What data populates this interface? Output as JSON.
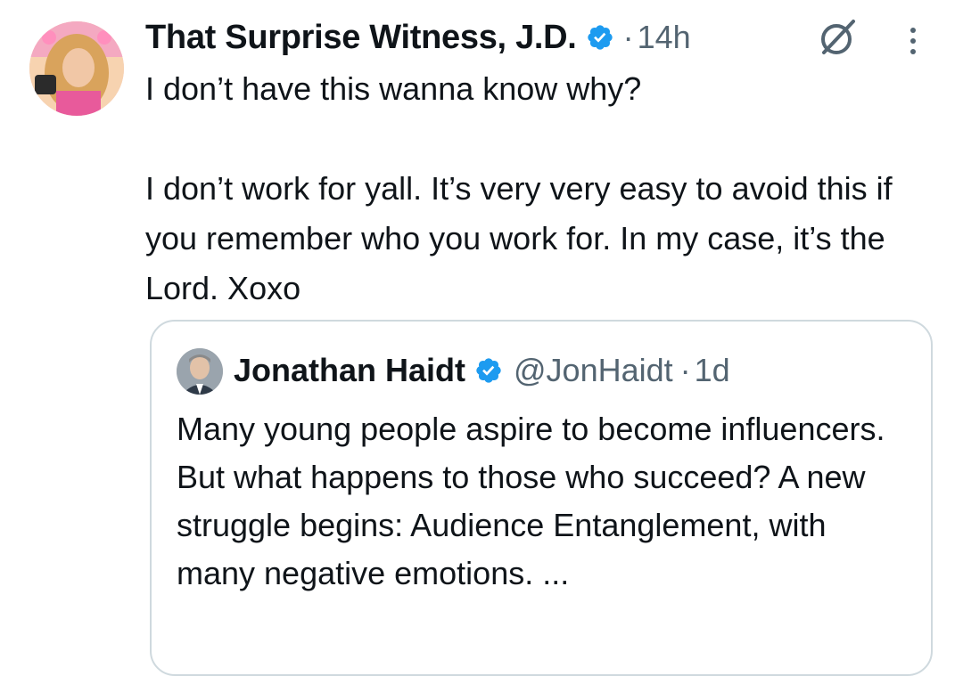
{
  "tweet": {
    "display_name": "That Surprise Witness, J.D.",
    "dot": "·",
    "time": "14h",
    "text": "I don’t have this wanna know why?\n\nI don’t work for yall. It’s very very easy to avoid this if you remember who you work for. In my case, it’s the Lord. Xoxo",
    "verified_color": "#1d9bf0"
  },
  "quoted": {
    "display_name": "Jonathan Haidt",
    "handle": "@JonHaidt",
    "dot": "·",
    "time": "1d",
    "text": "Many young people aspire to become influencers. But what happens to those who succeed? A new struggle begins: Audience Entanglement, with many negative emotions. ...",
    "verified_color": "#1d9bf0"
  },
  "icons": {
    "author_avatar": "avatar-photo",
    "verified": "verified-badge-icon",
    "grok": "grok-icon",
    "more": "more-vertical-icon",
    "quoted_avatar": "avatar-photo"
  }
}
